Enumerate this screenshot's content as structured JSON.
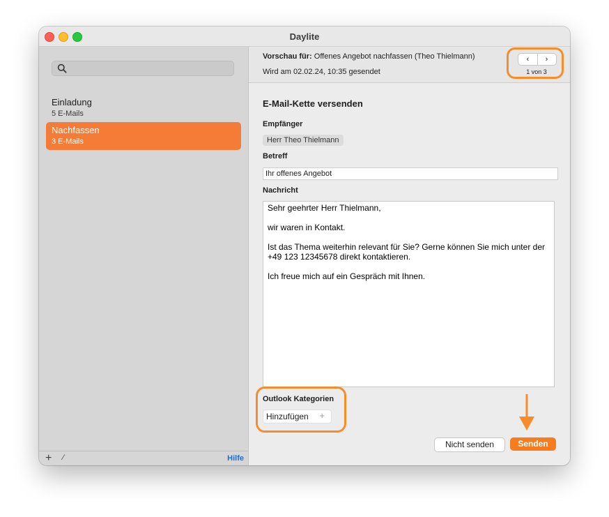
{
  "window": {
    "title": "Daylite"
  },
  "sidebar": {
    "search_placeholder": "",
    "sequences": [
      {
        "title": "Einladung",
        "count": "5 E-Mails",
        "selected": false
      },
      {
        "title": "Nachfassen",
        "count": "3 E-Mails",
        "selected": true
      }
    ],
    "footer": {
      "add": "+",
      "edit": "⁄",
      "help": "Hilfe"
    }
  },
  "preview": {
    "label": "Vorschau für:",
    "value": "Offenes Angebot nachfassen (Theo Thielmann)",
    "sent": "Wird am 02.02.24, 10:35 gesendet",
    "nav_prev": "‹",
    "nav_next": "›",
    "counter": "1 von 3"
  },
  "form": {
    "section_title": "E-Mail-Kette versenden",
    "recipient_label": "Empfänger",
    "recipient": "Herr Theo Thielmann",
    "subject_label": "Betreff",
    "subject": "Ihr offenes Angebot",
    "message_label": "Nachricht",
    "message_lines": [
      "Sehr geehrter Herr Thielmann,",
      "wir waren in Kontakt.",
      "Ist das Thema weiterhin relevant für Sie? Gerne können Sie mich unter der",
      "+49 123 12345678 direkt kontaktieren.",
      "Ich freue mich auf ein Gespräch mit Ihnen."
    ],
    "outlook_label": "Outlook Kategorien",
    "add_category": "Hinzufügen",
    "add_category_plus": "+"
  },
  "actions": {
    "dont_send": "Nicht senden",
    "send": "Senden"
  },
  "colors": {
    "accent": "#f57c1f",
    "selection": "#f57c37",
    "highlight": "#f78c2b",
    "link": "#1e6fd4"
  }
}
